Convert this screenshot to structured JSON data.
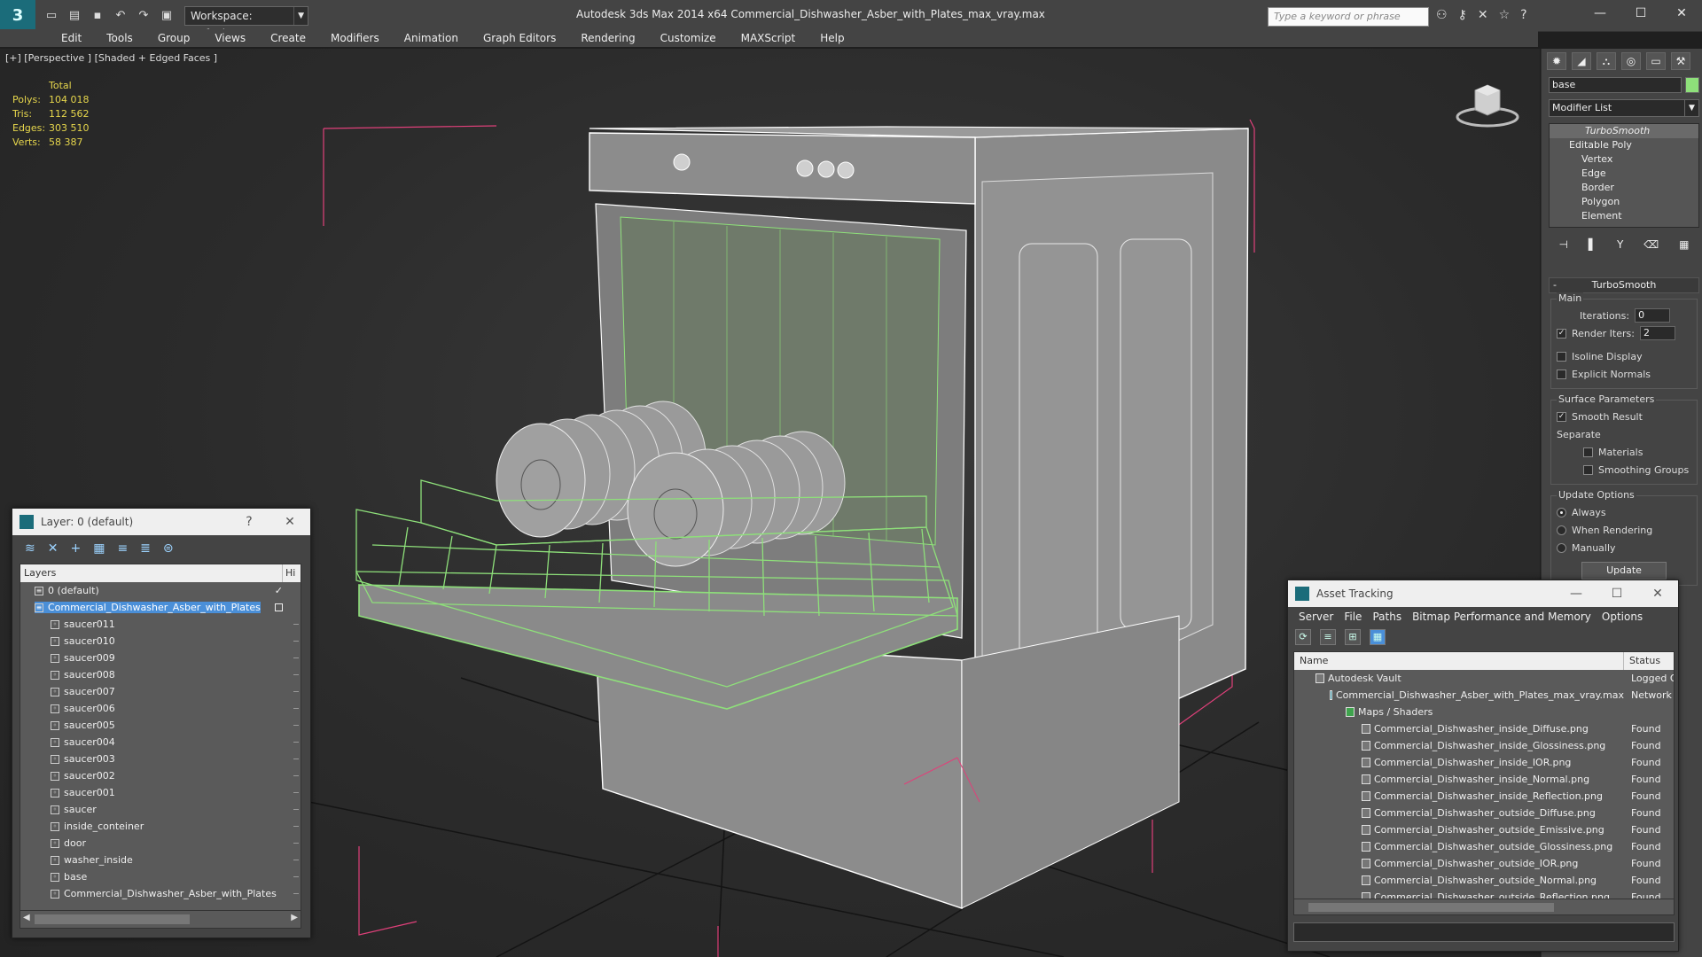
{
  "titlebar": {
    "workspace": "Workspace: Default",
    "title": "Autodesk 3ds Max  2014 x64      Commercial_Dishwasher_Asber_with_Plates_max_vray.max",
    "search_placeholder": "Type a keyword or phrase"
  },
  "menu": [
    "Edit",
    "Tools",
    "Group",
    "Views",
    "Create",
    "Modifiers",
    "Animation",
    "Graph Editors",
    "Rendering",
    "Customize",
    "MAXScript",
    "Help"
  ],
  "viewport": {
    "label": "[+] [Perspective ] [Shaded + Edged Faces ]",
    "stats_header": "Total",
    "stats": [
      {
        "k": "Polys:",
        "v": "104 018"
      },
      {
        "k": "Tris:",
        "v": "112 562"
      },
      {
        "k": "Edges:",
        "v": "303 510"
      },
      {
        "k": "Verts:",
        "v": "58 387"
      }
    ]
  },
  "command_panel": {
    "object_name": "base",
    "modifier_list": "Modifier List",
    "stack": {
      "top": "TurboSmooth",
      "base": "Editable Poly",
      "subs": [
        "Vertex",
        "Edge",
        "Border",
        "Polygon",
        "Element"
      ]
    },
    "rollout_title": "TurboSmooth",
    "main_group": "Main",
    "iterations_label": "Iterations:",
    "iterations_value": "0",
    "render_iters_label": "Render Iters:",
    "render_iters_value": "2",
    "isoline": "Isoline Display",
    "explicit_normals": "Explicit Normals",
    "surface_group": "Surface Parameters",
    "smooth_result": "Smooth Result",
    "separate": "Separate",
    "materials": "Materials",
    "smoothing_groups": "Smoothing Groups",
    "update_group": "Update Options",
    "always": "Always",
    "when_rendering": "When Rendering",
    "manually": "Manually",
    "update_button": "Update"
  },
  "layer_dialog": {
    "title": "Layer: 0 (default)",
    "help": "?",
    "col_layers": "Layers",
    "col_hide": "Hi",
    "rows": [
      {
        "name": "0 (default)",
        "indent": 16,
        "kind": "layer"
      },
      {
        "name": "Commercial_Dishwasher_Asber_with_Plates",
        "indent": 16,
        "kind": "layer",
        "selected": true
      },
      {
        "name": "saucer011",
        "indent": 34,
        "kind": "obj"
      },
      {
        "name": "saucer010",
        "indent": 34,
        "kind": "obj"
      },
      {
        "name": "saucer009",
        "indent": 34,
        "kind": "obj"
      },
      {
        "name": "saucer008",
        "indent": 34,
        "kind": "obj"
      },
      {
        "name": "saucer007",
        "indent": 34,
        "kind": "obj"
      },
      {
        "name": "saucer006",
        "indent": 34,
        "kind": "obj"
      },
      {
        "name": "saucer005",
        "indent": 34,
        "kind": "obj"
      },
      {
        "name": "saucer004",
        "indent": 34,
        "kind": "obj"
      },
      {
        "name": "saucer003",
        "indent": 34,
        "kind": "obj"
      },
      {
        "name": "saucer002",
        "indent": 34,
        "kind": "obj"
      },
      {
        "name": "saucer001",
        "indent": 34,
        "kind": "obj"
      },
      {
        "name": "saucer",
        "indent": 34,
        "kind": "obj"
      },
      {
        "name": "inside_conteiner",
        "indent": 34,
        "kind": "obj"
      },
      {
        "name": "door",
        "indent": 34,
        "kind": "obj"
      },
      {
        "name": "washer_inside",
        "indent": 34,
        "kind": "obj"
      },
      {
        "name": "base",
        "indent": 34,
        "kind": "obj"
      },
      {
        "name": "Commercial_Dishwasher_Asber_with_Plates",
        "indent": 34,
        "kind": "obj"
      }
    ]
  },
  "asset_dialog": {
    "title": "Asset Tracking",
    "menu": [
      "Server",
      "File",
      "Paths",
      "Bitmap Performance and Memory",
      "Options"
    ],
    "col_name": "Name",
    "col_status": "Status",
    "rows": [
      {
        "name": "Autodesk Vault",
        "status": "Logged O",
        "indent": 24,
        "icon": "vault"
      },
      {
        "name": "Commercial_Dishwasher_Asber_with_Plates_max_vray.max",
        "status": "Network F",
        "indent": 40,
        "icon": "max"
      },
      {
        "name": "Maps / Shaders",
        "status": "",
        "indent": 58,
        "icon": "maps"
      },
      {
        "name": "Commercial_Dishwasher_inside_Diffuse.png",
        "status": "Found",
        "indent": 76,
        "icon": "file"
      },
      {
        "name": "Commercial_Dishwasher_inside_Glossiness.png",
        "status": "Found",
        "indent": 76,
        "icon": "file"
      },
      {
        "name": "Commercial_Dishwasher_inside_IOR.png",
        "status": "Found",
        "indent": 76,
        "icon": "file"
      },
      {
        "name": "Commercial_Dishwasher_inside_Normal.png",
        "status": "Found",
        "indent": 76,
        "icon": "file"
      },
      {
        "name": "Commercial_Dishwasher_inside_Reflection.png",
        "status": "Found",
        "indent": 76,
        "icon": "file"
      },
      {
        "name": "Commercial_Dishwasher_outside_Diffuse.png",
        "status": "Found",
        "indent": 76,
        "icon": "file"
      },
      {
        "name": "Commercial_Dishwasher_outside_Emissive.png",
        "status": "Found",
        "indent": 76,
        "icon": "file"
      },
      {
        "name": "Commercial_Dishwasher_outside_Glossiness.png",
        "status": "Found",
        "indent": 76,
        "icon": "file"
      },
      {
        "name": "Commercial_Dishwasher_outside_IOR.png",
        "status": "Found",
        "indent": 76,
        "icon": "file"
      },
      {
        "name": "Commercial_Dishwasher_outside_Normal.png",
        "status": "Found",
        "indent": 76,
        "icon": "file"
      },
      {
        "name": "Commercial_Dishwasher_outside_Reflection.png",
        "status": "Found",
        "indent": 76,
        "icon": "file"
      }
    ]
  },
  "colors": {
    "accent": "#4a8fd8",
    "wire_green": "#8ee07a",
    "bbox_pink": "#e0407a",
    "stats_yellow": "#e6d64c"
  }
}
